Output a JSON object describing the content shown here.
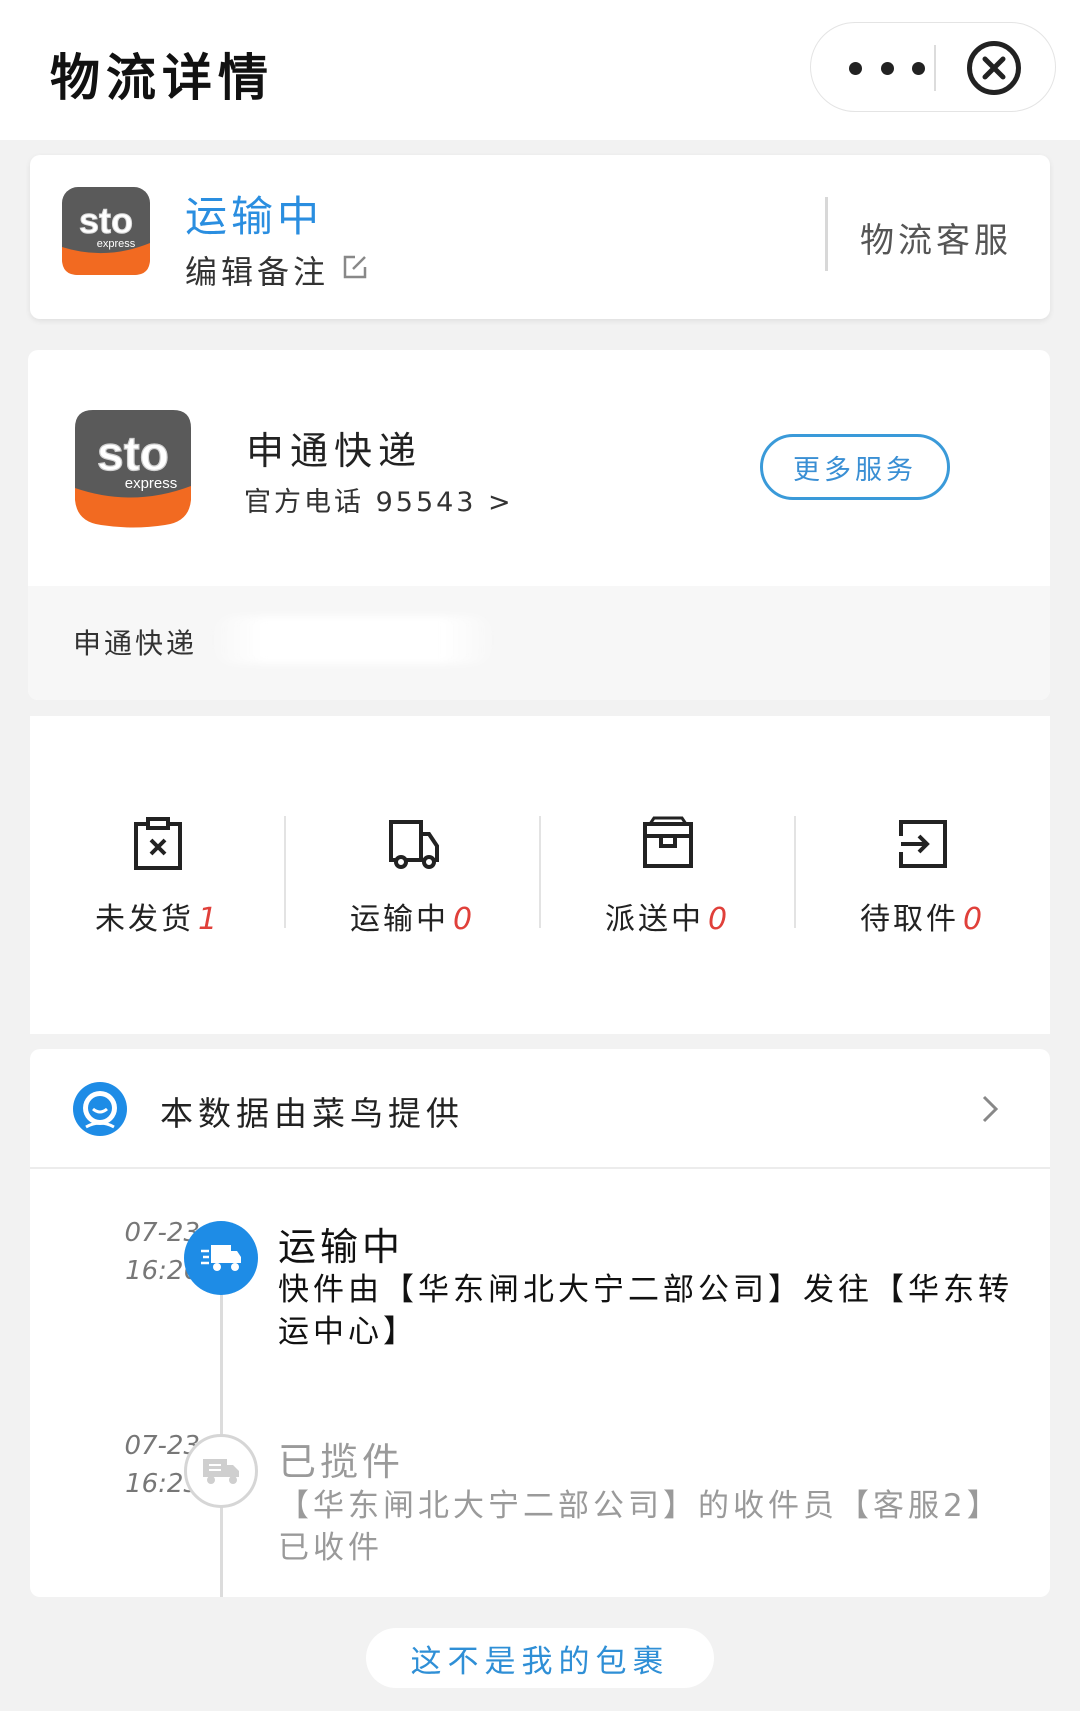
{
  "header": {
    "title": "物流详情"
  },
  "status": {
    "state": "运输中",
    "edit_note": "编辑备注",
    "customer_service": "物流客服"
  },
  "company": {
    "name": "申通快递",
    "phone": "官方电话 95543 >",
    "more_services": "更多服务",
    "tracking_label": "申通快递",
    "logo_text": "sto",
    "logo_subtext": "express"
  },
  "stats": [
    {
      "label": "未发货",
      "count": "1"
    },
    {
      "label": "运输中",
      "count": "0"
    },
    {
      "label": "派送中",
      "count": "0"
    },
    {
      "label": "待取件",
      "count": "0"
    }
  ],
  "provider": {
    "text": "本数据由菜鸟提供"
  },
  "events": [
    {
      "date": "07-23",
      "time": "16:26",
      "title": "运输中",
      "desc": "快件由【华东闸北大宁二部公司】发往【华东转运中心】"
    },
    {
      "date": "07-23",
      "time": "16:23",
      "title": "已揽件",
      "desc": "【华东闸北大宁二部公司】的收件员【客服2】已收件"
    }
  ],
  "footer": {
    "not_mine": "这不是我的包裹"
  },
  "colors": {
    "accent": "#2a8ee0",
    "count_red": "#e0403a",
    "logo_gray": "#5a5a5a",
    "logo_orange": "#f26a21"
  }
}
